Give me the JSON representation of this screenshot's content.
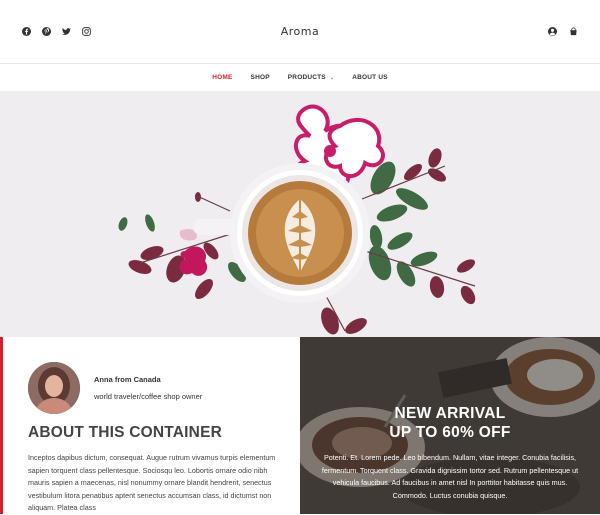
{
  "header": {
    "brand": "Aroma",
    "social_icons": [
      "facebook-icon",
      "pinterest-icon",
      "twitter-icon",
      "instagram-icon"
    ],
    "util_icons": [
      "account-icon",
      "cart-icon"
    ]
  },
  "nav": {
    "items": [
      {
        "label": "HOME",
        "active": true
      },
      {
        "label": "SHOP",
        "active": false
      },
      {
        "label": "PRODUCTS",
        "active": false
      },
      {
        "label": "ABOUT US",
        "active": false
      }
    ],
    "products_caret": "⌄"
  },
  "about": {
    "author_name": "Anna from Canada",
    "author_role": "world traveler/coffee shop owner",
    "title": "ABOUT THIS CONTAINER",
    "body": "Inceptos dapibus dictum, consequat. Augue rutrum vivamus turpis elementum sapien torquent class pellentesque. Sociosqu leo. Lobortis ornare odio nibh mauris sapien a maecenas, nisl nonummy ornare blandit hendrerit, senectus vestibulum litora penatibus aptent senectus accumsan class, id dictumst non aliquam. Platea class"
  },
  "promo": {
    "line1": "NEW ARRIVAL",
    "line2": "UP TO 60% OFF",
    "body": "Potenti. Et. Lorem pede. Leo bibendum. Nullam, vitae integer. Conubia facilisis, fermentum. Torquent class. Gravida dignissim tortor sed. Rutrum pellentesque ut vehicula faucibus. Ad faucibus in amet nisl In porttitor habitasse quis mus. Commodo. Luctus conubia quisque."
  },
  "colors": {
    "accent": "#d21f2a",
    "hero_bg": "#efedf0",
    "text": "#333333"
  }
}
